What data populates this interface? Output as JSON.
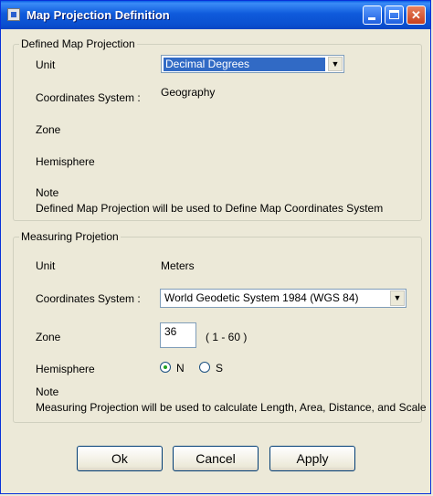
{
  "window": {
    "title": "Map Projection Definition"
  },
  "defined": {
    "legend": "Defined  Map Projection",
    "unit_label": "Unit",
    "unit_value": "Decimal Degrees",
    "coords_label": "Coordinates System :",
    "coords_value": "Geography",
    "zone_label": "Zone",
    "hemisphere_label": "Hemisphere",
    "note_label": "Note",
    "note_text": "Defined Map Projection will be used to Define Map Coordinates System"
  },
  "measuring": {
    "legend": "Measuring Projetion",
    "unit_label": "Unit",
    "unit_value": "Meters",
    "coords_label": "Coordinates System :",
    "coords_value": "World Geodetic System 1984 (WGS 84)",
    "zone_label": "Zone",
    "zone_value": "36",
    "zone_range": "( 1 - 60 )",
    "hemisphere_label": "Hemisphere",
    "hemisphere_north": "N",
    "hemisphere_south": "S",
    "hemisphere_selected": "N",
    "note_label": "Note",
    "note_text": "Measuring Projection will be used to calculate Length, Area, Distance, and Scale"
  },
  "buttons": {
    "ok": "Ok",
    "cancel": "Cancel",
    "apply": "Apply"
  }
}
